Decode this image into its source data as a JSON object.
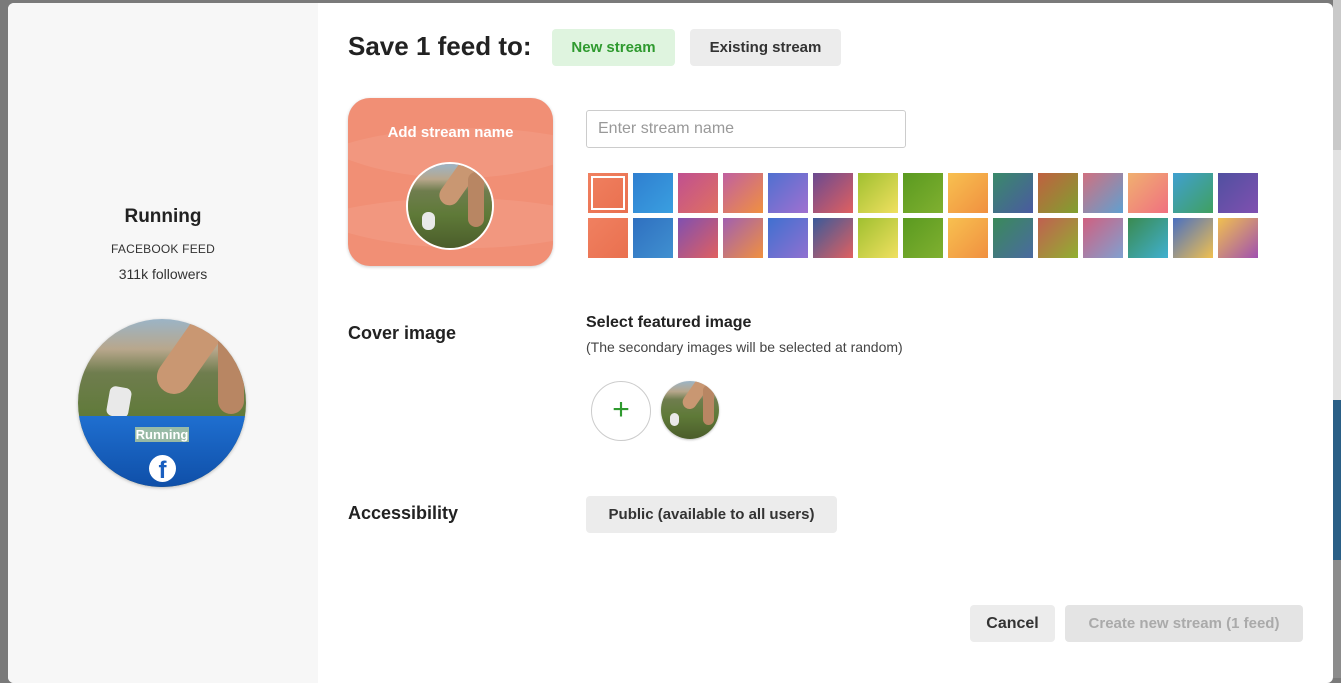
{
  "sidebar": {
    "feed_title": "Running",
    "feed_type": "FACEBOOK FEED",
    "followers": "311k followers",
    "avatar_label": "Running",
    "network_icon": "facebook-icon"
  },
  "header": {
    "title": "Save 1 feed to:",
    "tab_new": "New stream",
    "tab_existing": "Existing stream",
    "active_tab": "New stream"
  },
  "preview": {
    "label": "Add stream name"
  },
  "stream_name": {
    "value": "",
    "placeholder": "Enter stream name"
  },
  "swatches": {
    "selected_index": 0,
    "colors": [
      "#f08060,#e9704f",
      "#2f7fd0,#3a9fe0",
      "#c05090,#e07060",
      "#c060a0,#f09040",
      "#5070d0,#a070d0",
      "#6a4a90,#e06060",
      "#a0c030,#f0e060",
      "#5a9a20,#80b030",
      "#f8c050,#f09040",
      "#3a8a6a,#4a5aa0",
      "#c06040,#80a030",
      "#d07080,#60a0d0",
      "#f0b070,#f07080",
      "#40a0d0,#40a060",
      "#5050a0,#8050b0",
      "#f08060,#e9704f",
      "#2f70c0,#4090d0",
      "#8050b0,#e06060",
      "#a060b0,#f09040",
      "#4070d0,#9070d0",
      "#3a5a9a,#e06060",
      "#a0c030,#f0e060",
      "#5a9a20,#80b030",
      "#f8c050,#f09040",
      "#3a8a5a,#4a6aa0",
      "#c06050,#90b030",
      "#d06080,#80a0d0",
      "#3a8a50,#40b0d0",
      "#4a70c0,#f0c050",
      "#f0c050,#a050b0"
    ]
  },
  "cover": {
    "label": "Cover image",
    "select_title": "Select featured image",
    "select_subtitle": "(The secondary images will be selected at random)",
    "add_icon": "plus-icon"
  },
  "accessibility": {
    "label": "Accessibility",
    "value": "Public (available to all users)"
  },
  "footer": {
    "cancel": "Cancel",
    "create": "Create new stream (1 feed)"
  }
}
